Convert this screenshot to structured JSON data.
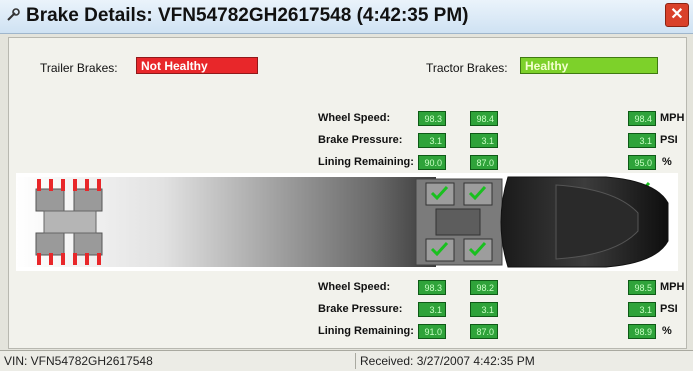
{
  "window": {
    "title": "Brake Details: VFN54782GH2617548 (4:42:35 PM)",
    "close_glyph": "✕"
  },
  "trailer": {
    "label": "Trailer Brakes:",
    "status": "Not Healthy"
  },
  "tractor": {
    "label": "Tractor Brakes:",
    "status": "Healthy"
  },
  "labels": {
    "wheel_speed": "Wheel Speed:",
    "brake_pressure": "Brake Pressure:",
    "lining_remaining": "Lining Remaining:"
  },
  "units": {
    "speed": "MPH",
    "pressure": "PSI",
    "lining": "%"
  },
  "top": {
    "wheel_speed": [
      "98.3",
      "98.4",
      "98.4"
    ],
    "brake_pressure": [
      "3.1",
      "3.1",
      "3.1"
    ],
    "lining_remaining": [
      "90.0",
      "87.0",
      "95.0"
    ]
  },
  "bottom": {
    "wheel_speed": [
      "98.3",
      "98.2",
      "98.5"
    ],
    "brake_pressure": [
      "3.1",
      "3.1",
      "3.1"
    ],
    "lining_remaining": [
      "91.0",
      "87.0",
      "98.9"
    ]
  },
  "statusbar": {
    "vin": "VIN: VFN54782GH2617548",
    "received": "Received: 3/27/2007 4:42:35 PM"
  },
  "colors": {
    "bad": "#e8272a",
    "good": "#7dd12a",
    "value_box": "#2fa33a"
  }
}
